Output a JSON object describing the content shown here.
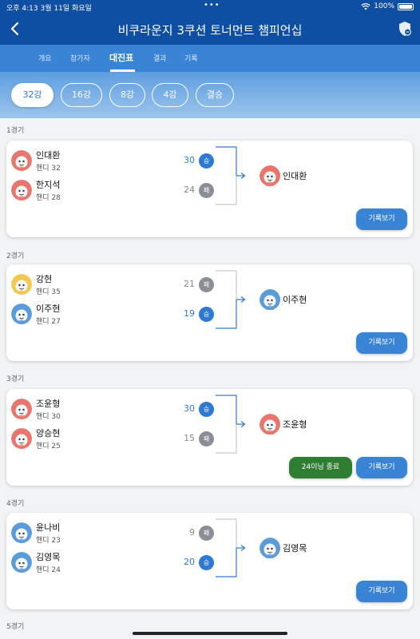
{
  "status_bar": {
    "time_date": "오후 4:13  3월 11일 화요일",
    "dots": "•••",
    "battery": "100%"
  },
  "header": {
    "title": "비쿠라운지 3쿠션 토너먼트 챔피언십",
    "back_icon": "back-chevron-icon",
    "shield_icon": "shield-icon"
  },
  "tabs": [
    {
      "label": "개요"
    },
    {
      "label": "참가자"
    },
    {
      "label": "대진표",
      "active": true
    },
    {
      "label": "결과"
    },
    {
      "label": "기록"
    }
  ],
  "rounds": [
    {
      "label": "32강",
      "active": true
    },
    {
      "label": "16강"
    },
    {
      "label": "8강"
    },
    {
      "label": "4강"
    },
    {
      "label": "결승"
    }
  ],
  "matches": [
    {
      "label": "1경기",
      "players": [
        {
          "name": "인대환",
          "handi": "핸디 32",
          "score": "30",
          "result": "승",
          "avatar": "red"
        },
        {
          "name": "한지석",
          "handi": "핸디 28",
          "score": "24",
          "result": "패",
          "avatar": "red"
        }
      ],
      "winner": {
        "name": "인대환",
        "avatar": "red"
      },
      "record_label": "기록보기"
    },
    {
      "label": "2경기",
      "players": [
        {
          "name": "강현",
          "handi": "핸디 35",
          "score": "21",
          "result": "패",
          "avatar": "yellow"
        },
        {
          "name": "이주현",
          "handi": "핸디 27",
          "score": "19",
          "result": "승",
          "avatar": "blue"
        }
      ],
      "winner": {
        "name": "이주현",
        "avatar": "blue"
      },
      "record_label": "기록보기"
    },
    {
      "label": "3경기",
      "players": [
        {
          "name": "조윤형",
          "handi": "핸디 30",
          "score": "30",
          "result": "승",
          "avatar": "red"
        },
        {
          "name": "양승현",
          "handi": "핸디 25",
          "score": "15",
          "result": "패",
          "avatar": "red"
        }
      ],
      "winner": {
        "name": "조윤형",
        "avatar": "red"
      },
      "inning_label": "24이닝 종료",
      "record_label": "기록보기"
    },
    {
      "label": "4경기",
      "players": [
        {
          "name": "윤나비",
          "handi": "핸디 23",
          "score": "9",
          "result": "패",
          "avatar": "blue"
        },
        {
          "name": "김영목",
          "handi": "핸디 24",
          "score": "20",
          "result": "승",
          "avatar": "blue"
        }
      ],
      "winner": {
        "name": "김영목",
        "avatar": "blue"
      },
      "record_label": "기록보기"
    }
  ],
  "next_match_label": "5경기",
  "colors": {
    "header": "#0e4fa3",
    "tab_bar": "#3a84d6",
    "win": "#2e7ad2",
    "lose": "#8a8f96",
    "inning_button": "#2e7d32",
    "avatar_red": "#e8766c",
    "avatar_yellow": "#f2c94c",
    "avatar_blue": "#5b9bd9"
  }
}
